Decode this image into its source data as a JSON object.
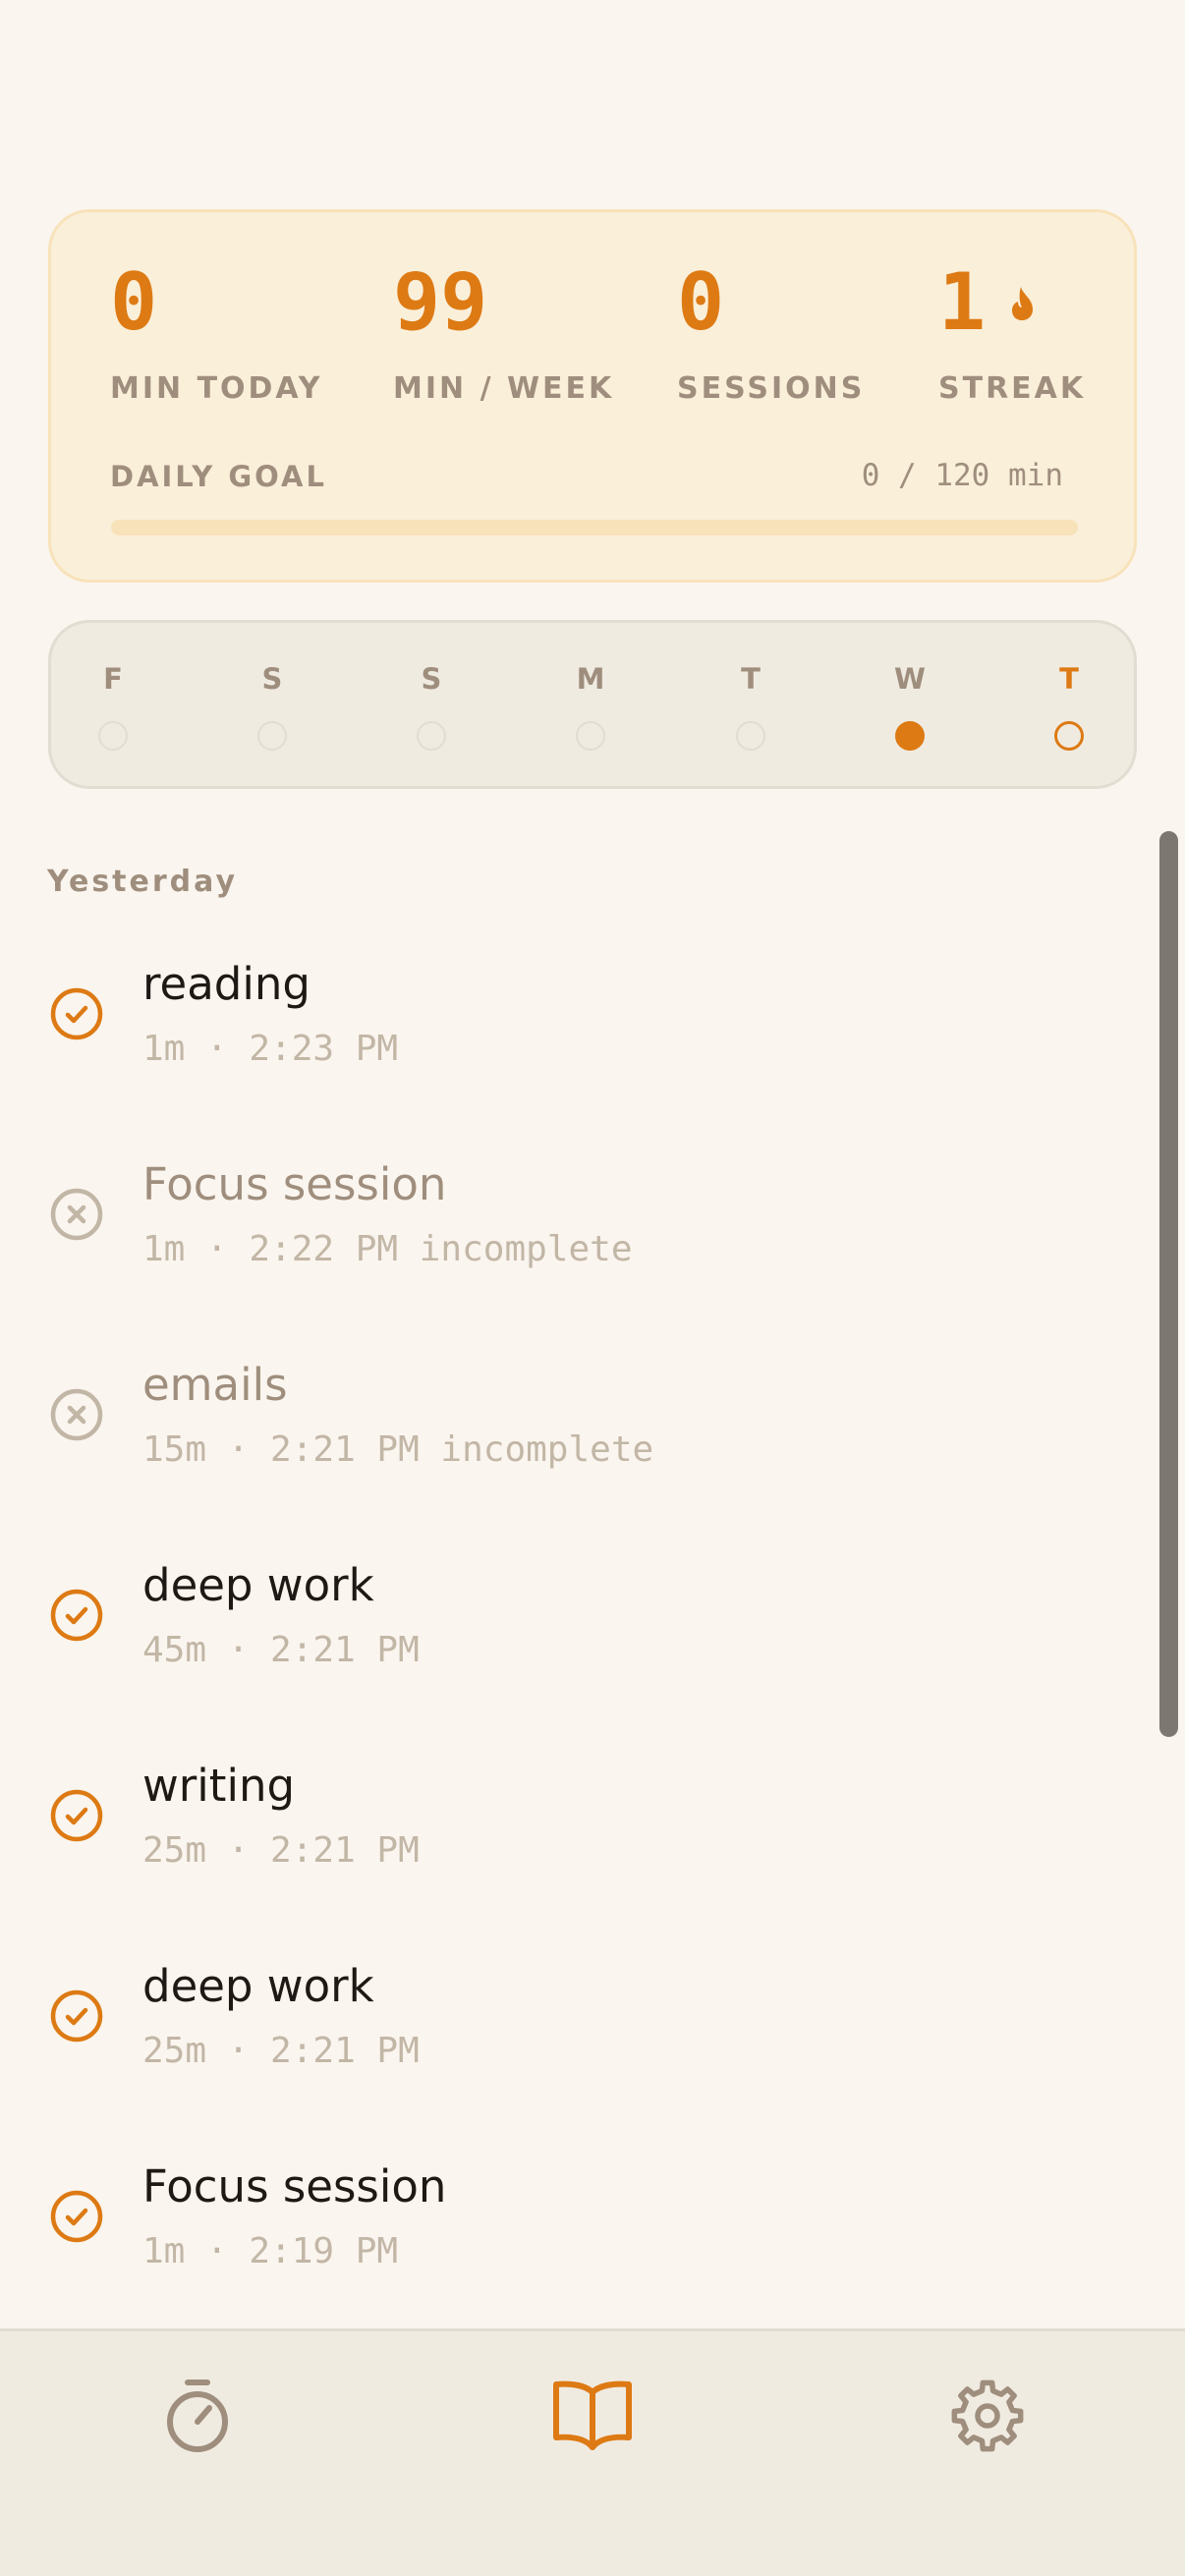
{
  "stats": {
    "min_today": {
      "value": "0",
      "label": "MIN TODAY"
    },
    "min_week": {
      "value": "99",
      "label": "MIN / WEEK"
    },
    "sessions": {
      "value": "0",
      "label": "SESSIONS"
    },
    "streak": {
      "value": "1",
      "label": "STREAK",
      "icon": "flame-icon"
    }
  },
  "goal": {
    "label": "DAILY GOAL",
    "value_text": "0 / 120 min",
    "progress_fraction": 0
  },
  "week": {
    "days": [
      {
        "letter": "F",
        "state": "empty"
      },
      {
        "letter": "S",
        "state": "empty"
      },
      {
        "letter": "S",
        "state": "empty"
      },
      {
        "letter": "M",
        "state": "empty"
      },
      {
        "letter": "T",
        "state": "empty"
      },
      {
        "letter": "W",
        "state": "filled"
      },
      {
        "letter": "T",
        "state": "today"
      }
    ]
  },
  "list": {
    "section": "Yesterday",
    "items": [
      {
        "title": "reading",
        "meta": "1m · 2:23 PM",
        "status": "complete"
      },
      {
        "title": "Focus session",
        "meta": "1m · 2:22 PM incomplete",
        "status": "incomplete"
      },
      {
        "title": "emails",
        "meta": "15m · 2:21 PM incomplete",
        "status": "incomplete"
      },
      {
        "title": "deep work",
        "meta": "45m · 2:21 PM",
        "status": "complete"
      },
      {
        "title": "writing",
        "meta": "25m · 2:21 PM",
        "status": "complete"
      },
      {
        "title": "deep work",
        "meta": "25m · 2:21 PM",
        "status": "complete"
      },
      {
        "title": "Focus session",
        "meta": "1m · 2:19 PM",
        "status": "complete"
      }
    ]
  },
  "nav": {
    "items": [
      {
        "name": "timer",
        "icon": "stopwatch-icon",
        "active": false
      },
      {
        "name": "history",
        "icon": "book-open-icon",
        "active": true
      },
      {
        "name": "settings",
        "icon": "gear-icon",
        "active": false
      }
    ]
  },
  "colors": {
    "accent": "#DD7A14",
    "muted": "#9F8E7D",
    "text": "#1E1914",
    "meta": "#C2B6A6",
    "background": "#FAF5EE"
  }
}
